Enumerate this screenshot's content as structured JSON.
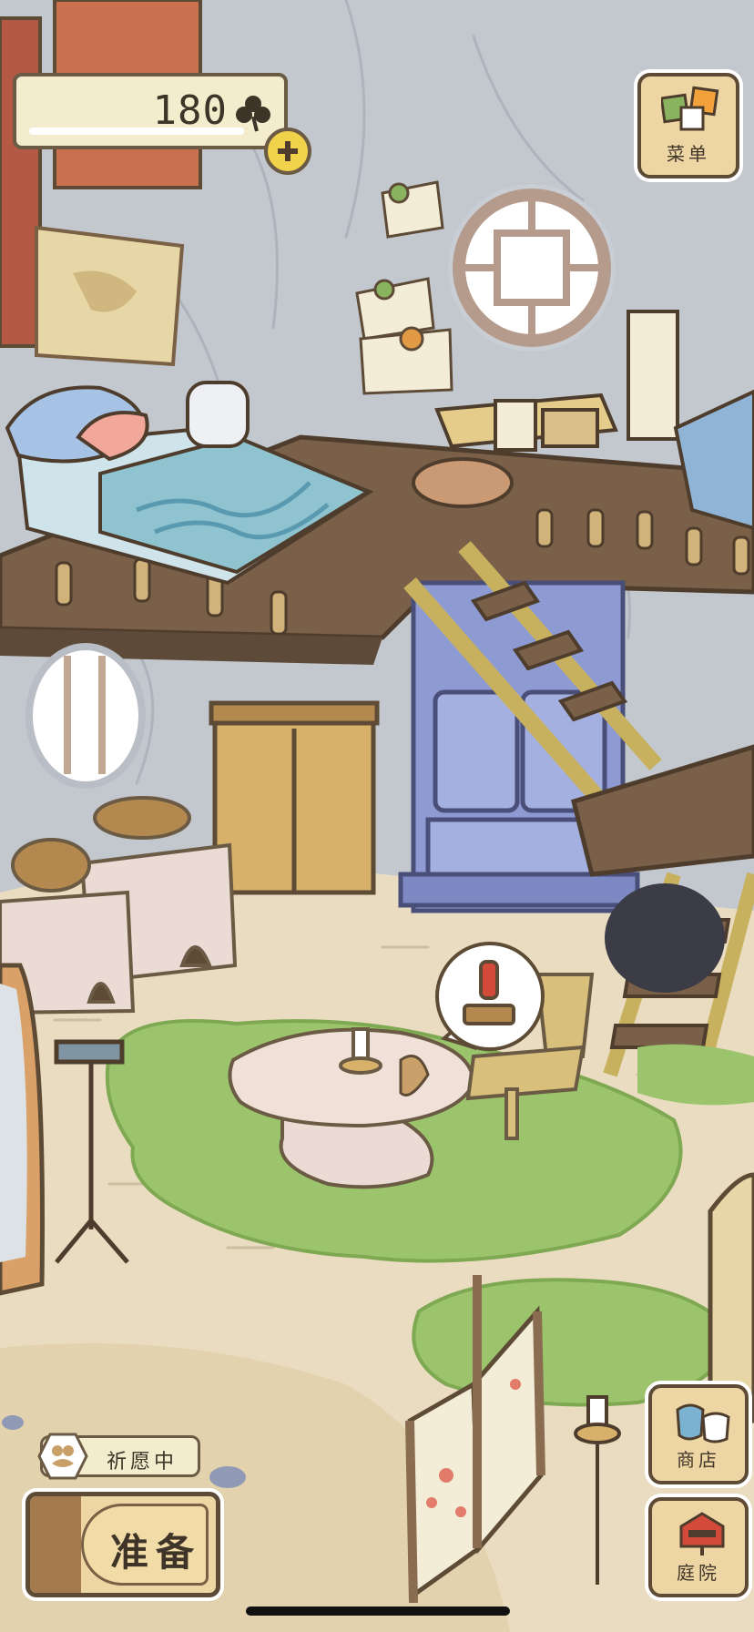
{
  "hud": {
    "clover_count": "180",
    "clover_icon": "clover-icon",
    "add_icon": "plus-icon"
  },
  "side_buttons": {
    "menu_label": "菜单",
    "shop_label": "商店",
    "yard_label": "庭院"
  },
  "wish_status": {
    "label": "祈愿中",
    "icon": "frog-icon"
  },
  "prepare_button": {
    "label": "准备"
  },
  "alert_bubble": {
    "icon": "exclamation-icon"
  },
  "colors": {
    "wall": "#c3c8cf",
    "floor": "#e9dcc0",
    "rug": "#9cc46c",
    "wood": "#7a6048",
    "cabinet": "#8e9bd2",
    "button_bg": "#eed6a4",
    "outline": "#5e4b36"
  }
}
